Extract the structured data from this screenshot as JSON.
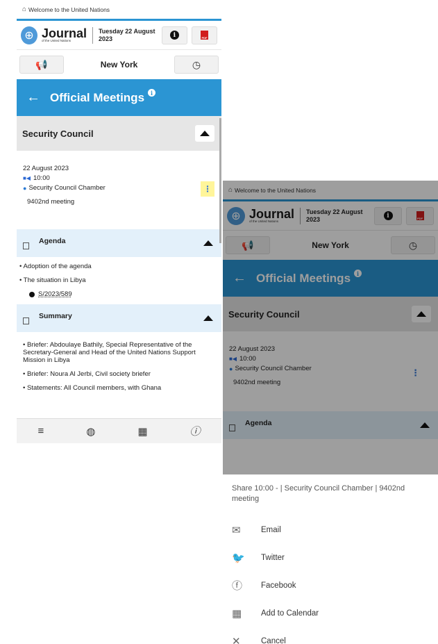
{
  "welcome_text": "Welcome to the United Nations",
  "brand": {
    "title": "Journal",
    "subtitle": "of the United Nations"
  },
  "header_date": "Tuesday 22 August 2023",
  "location": "New York",
  "page_title": "Official Meetings",
  "body_name": "Security Council",
  "meeting": {
    "date": "22 August 2023",
    "time": "10:00",
    "room": "Security Council Chamber",
    "number": "9402nd meeting"
  },
  "agenda": {
    "label": "Agenda",
    "items": [
      "Adoption of the agenda",
      "The situation in Libya"
    ],
    "document": "S/2023/589"
  },
  "summary": {
    "label": "Summary",
    "items": [
      "Briefer: Abdoulaye Bathily, Special Representative of the Secretary-General and Head of the United Nations Support Mission in Libya",
      "Briefer: Noura Al Jerbi, Civil society briefer",
      "Statements: All Council members, with Ghana"
    ]
  },
  "share_sheet": {
    "title": "Share 10:00 - | Security Council Chamber | 9402nd meeting",
    "options": [
      "Email",
      "Twitter",
      "Facebook",
      "Add to Calendar",
      "Cancel"
    ]
  },
  "icons": {
    "home": "home-icon",
    "back": "back-arrow-icon",
    "info": "info-icon",
    "pdf": "pdf-icon",
    "megaphone": "megaphone-icon",
    "clock": "clock-icon",
    "menu": "menu-icon",
    "globe": "globe-icon",
    "calendar": "calendar-icon",
    "more": "more-vert-icon"
  },
  "colors": {
    "accent": "#2b95d3",
    "highlight": "#fff59a",
    "subsection": "#e3f0fa"
  }
}
